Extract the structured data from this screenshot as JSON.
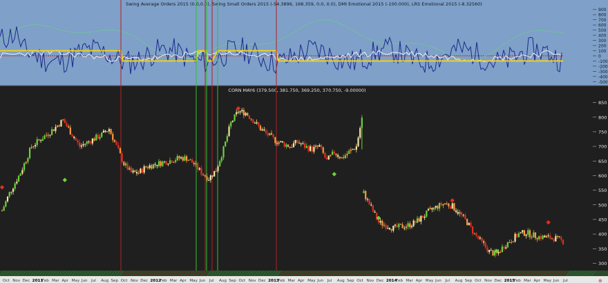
{
  "top_panel": {
    "title": "Swing Average Orders 2015 (0.0,0.0), Swing Small Orders 2015 (-54.3896, 168.359, 0.0, 0.0), DMI Emotional 2015 (-100.000), LRS Emotional 2015 (-8.32560)",
    "background": "#7fa0c8",
    "y_ticks": [
      "900",
      "800",
      "700",
      "600",
      "500",
      "400",
      "300",
      "200",
      "100",
      "0",
      "-100",
      "-200",
      "-300",
      "-400",
      "-500"
    ]
  },
  "main_panel": {
    "title": "CORN MAY6 (379.500, 381.750, 369.250, 370.750, -9.00000)",
    "background": "#1f1f1f",
    "y_ticks": [
      "850",
      "800",
      "750",
      "700",
      "650",
      "600",
      "550",
      "500",
      "450",
      "400",
      "350",
      "300"
    ]
  },
  "x_labels": [
    "Oct",
    "Nov",
    "Dec",
    "2011",
    "Feb",
    "Mar",
    "Apr",
    "May",
    "Jun",
    "Jul",
    "Aug",
    "Sep",
    "Oct",
    "Nov",
    "Dec",
    "2012",
    "Feb",
    "Mar",
    "Apr",
    "May",
    "Jun",
    "Jul",
    "Aug",
    "Sep",
    "Oct",
    "Nov",
    "Dec",
    "2013",
    "Feb",
    "Mar",
    "Apr",
    "May",
    "Jun",
    "Jul",
    "Aug",
    "Sep",
    "Oct",
    "Nov",
    "Dec",
    "2014",
    "Feb",
    "Mar",
    "Apr",
    "May",
    "Jun",
    "Jul",
    "Aug",
    "Sep",
    "Oct",
    "Nov",
    "Dec",
    "2015",
    "Feb",
    "Mar",
    "Apr",
    "May",
    "Jun",
    "Jul"
  ],
  "colors": {
    "up": "#6fd23c",
    "down": "#e03020",
    "neutral": "#ff9a40",
    "light": "#f3e7a0",
    "vline_red": "#b02020",
    "vline_green": "#30c030",
    "zero_line": "#d02020",
    "step_line": "#f0d020",
    "osc_blue": "#1a2a8c",
    "osc_white": "#f0f0f0",
    "osc_green": "#70c0a0"
  },
  "chart_data": {
    "type": "candlestick",
    "symbol": "CORN MAY6",
    "last_bar": {
      "open": 379.5,
      "high": 381.75,
      "low": 369.25,
      "close": 370.75,
      "change": -9.0
    },
    "ylim": [
      275,
      875
    ],
    "price_series": [
      {
        "segment": "2010-10 to 2013-07",
        "points": [
          [
            0,
            480
          ],
          [
            4,
            540
          ],
          [
            10,
            610
          ],
          [
            16,
            700
          ],
          [
            22,
            730
          ],
          [
            28,
            760
          ],
          [
            33,
            790
          ],
          [
            38,
            740
          ],
          [
            42,
            700
          ],
          [
            48,
            720
          ],
          [
            54,
            740
          ],
          [
            58,
            760
          ],
          [
            62,
            700
          ],
          [
            66,
            640
          ],
          [
            70,
            610
          ],
          [
            74,
            610
          ],
          [
            78,
            630
          ],
          [
            84,
            640
          ],
          [
            90,
            650
          ],
          [
            96,
            660
          ],
          [
            100,
            660
          ],
          [
            104,
            640
          ],
          [
            108,
            610
          ],
          [
            112,
            590
          ],
          [
            116,
            620
          ],
          [
            120,
            690
          ],
          [
            124,
            780
          ],
          [
            128,
            820
          ],
          [
            132,
            815
          ],
          [
            136,
            790
          ],
          [
            140,
            760
          ],
          [
            144,
            740
          ],
          [
            148,
            720
          ],
          [
            152,
            710
          ],
          [
            156,
            700
          ],
          [
            160,
            715
          ],
          [
            164,
            700
          ],
          [
            168,
            690
          ],
          [
            172,
            700
          ],
          [
            176,
            650
          ],
          [
            180,
            680
          ],
          [
            184,
            660
          ],
          [
            188,
            680
          ],
          [
            192,
            700
          ],
          [
            195,
            795
          ]
        ]
      },
      {
        "segment": "2013-08 to 2015-05",
        "points": [
          [
            196,
            540
          ],
          [
            200,
            490
          ],
          [
            204,
            440
          ],
          [
            208,
            430
          ],
          [
            212,
            420
          ],
          [
            216,
            425
          ],
          [
            220,
            430
          ],
          [
            224,
            440
          ],
          [
            228,
            460
          ],
          [
            232,
            480
          ],
          [
            236,
            495
          ],
          [
            240,
            505
          ],
          [
            244,
            495
          ],
          [
            248,
            470
          ],
          [
            252,
            440
          ],
          [
            256,
            400
          ],
          [
            260,
            370
          ],
          [
            264,
            340
          ],
          [
            268,
            330
          ],
          [
            272,
            360
          ],
          [
            276,
            380
          ],
          [
            280,
            400
          ],
          [
            284,
            405
          ],
          [
            288,
            395
          ],
          [
            292,
            390
          ],
          [
            296,
            388
          ],
          [
            300,
            385
          ],
          [
            304,
            375
          ]
        ]
      }
    ],
    "markers": {
      "red_diamonds": [
        [
          0,
          560
        ],
        [
          128,
          830
        ],
        [
          244,
          515
        ],
        [
          296,
          440
        ]
      ],
      "green_diamonds": [
        [
          34,
          585
        ],
        [
          180,
          605
        ],
        [
          204,
          455
        ],
        [
          268,
          342
        ]
      ]
    },
    "vertical_lines": {
      "red": [
        21,
        36,
        38,
        61,
        162
      ],
      "green": [
        34,
        37,
        43,
        50
      ]
    },
    "oscillator": {
      "ylim": [
        -550,
        950
      ],
      "step_line": [
        [
          0,
          100
        ],
        [
          20,
          100
        ],
        [
          21,
          -100
        ],
        [
          34,
          -100
        ],
        [
          35,
          100
        ],
        [
          37,
          100
        ],
        [
          38,
          -100
        ],
        [
          39,
          -100
        ],
        [
          40,
          100
        ],
        [
          48,
          100
        ],
        [
          49,
          -100
        ],
        [
          57,
          -100
        ],
        [
          58,
          100
        ],
        [
          61,
          100
        ],
        [
          62,
          -100
        ],
        [
          100,
          -100
        ]
      ]
    }
  }
}
